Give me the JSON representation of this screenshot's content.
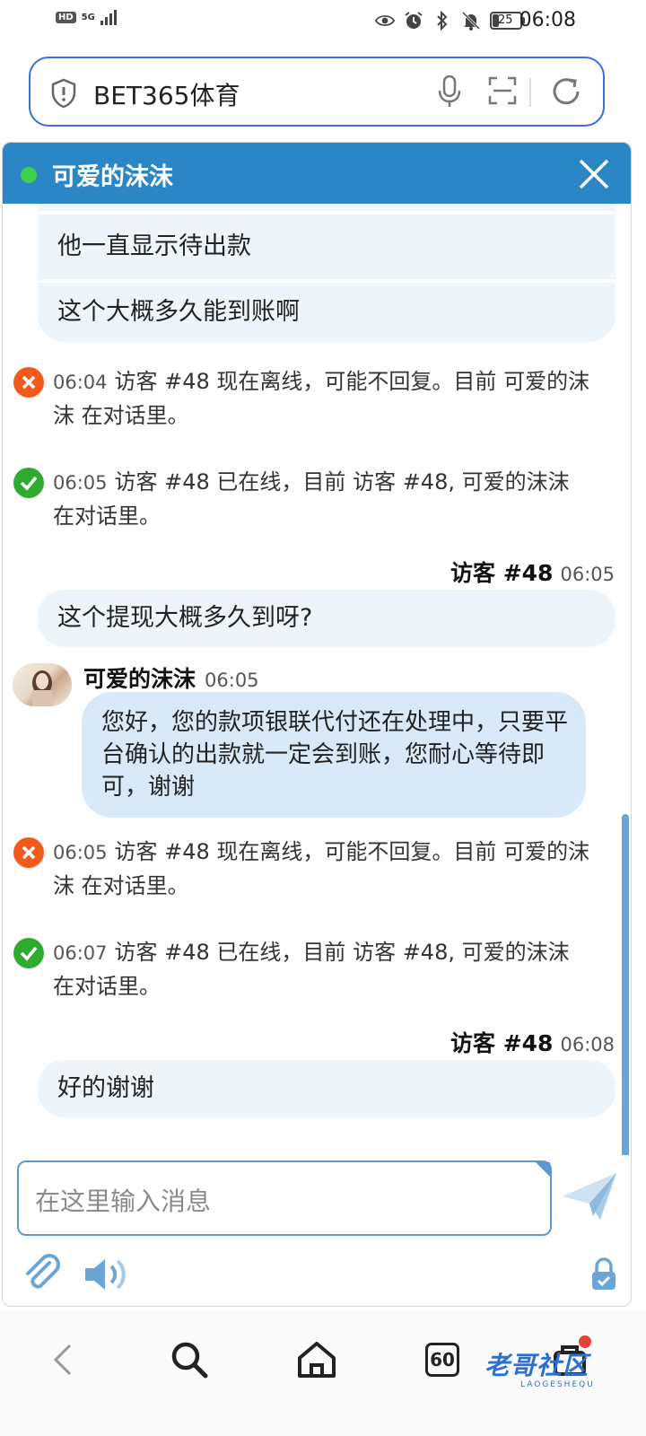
{
  "status_bar": {
    "hd": "HD",
    "network": "5G",
    "battery": "25",
    "time": "06:08"
  },
  "address_bar": {
    "url_text": "BET365体育"
  },
  "chat": {
    "title": "可爱的沫沫",
    "online_color": "#3dd04d",
    "header_color": "#2b86c5",
    "bubbles_top": [
      {
        "text": "他一直显示待出款"
      },
      {
        "text": "这个大概多久能到账啊"
      }
    ],
    "system_events": [
      {
        "status": "offline",
        "time": "06:04",
        "text": "访客 #48 现在离线，可能不回复。目前 可爱的沫沫 在对话里。"
      },
      {
        "status": "online",
        "time": "06:05",
        "text": "访客 #48 已在线，目前 访客 #48, 可爱的沫沫 在对话里。"
      },
      {
        "status": "offline",
        "time": "06:05",
        "text": "访客 #48 现在离线，可能不回复。目前 可爱的沫沫 在对话里。"
      },
      {
        "status": "online",
        "time": "06:07",
        "text": "访客 #48 已在线，目前 访客 #48, 可爱的沫沫 在对话里。"
      }
    ],
    "visitor_messages": [
      {
        "sender": "访客 #48",
        "time": "06:05",
        "text": "这个提现大概多久到呀?"
      },
      {
        "sender": "访客 #48",
        "time": "06:08",
        "text": "好的谢谢"
      }
    ],
    "operator_message": {
      "sender": "可爱的沫沫",
      "time": "06:05",
      "text": "您好，您的款项银联代付还在处理中，只要平台确认的出款就一定会到账，您耐心等待即可，谢谢"
    },
    "input_placeholder": "在这里输入消息"
  },
  "bottom_nav": {
    "tab_count": "60",
    "watermark": "老哥社区",
    "watermark_sub": "LAOGESHEQU"
  }
}
